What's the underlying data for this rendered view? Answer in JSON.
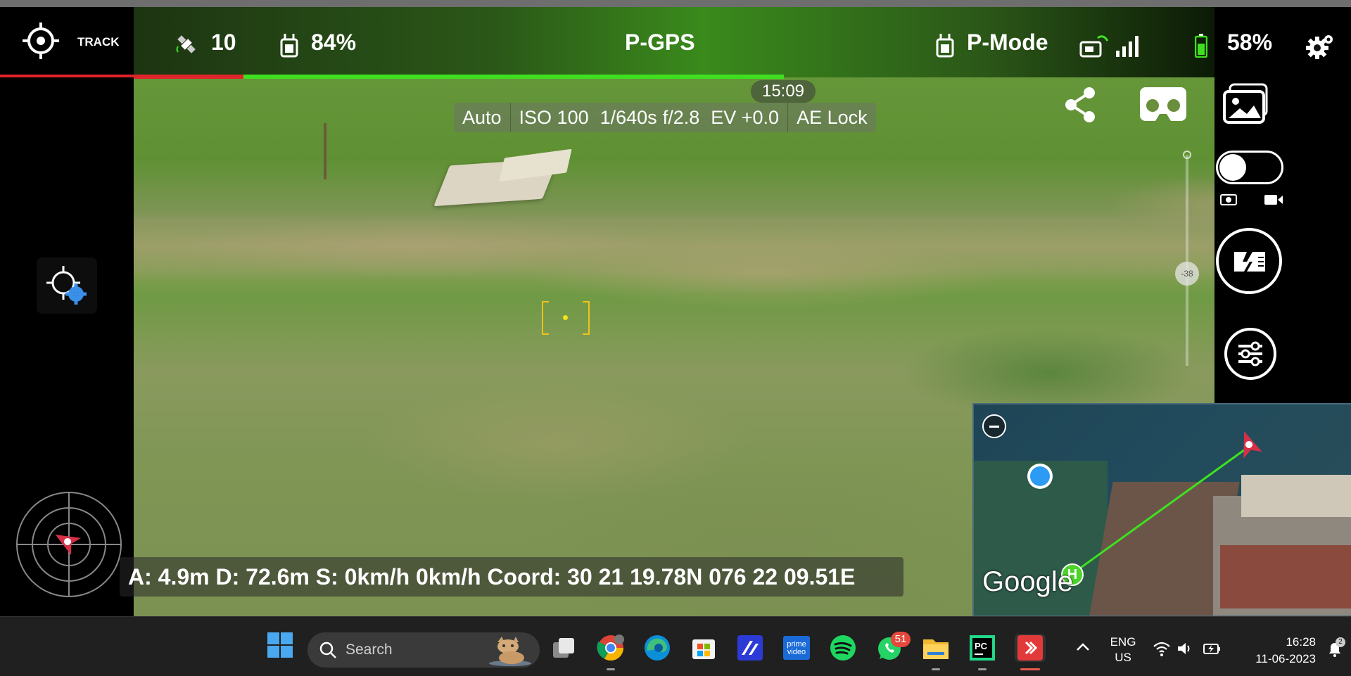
{
  "top_bar": {
    "track_label": "TRACK",
    "satellites": "10",
    "rc_battery": "84%",
    "gps_mode": "P-GPS",
    "flight_mode": "P-Mode",
    "aircraft_battery": "58%"
  },
  "progress": {
    "red_fraction": 0.18,
    "green_fraction": 0.58
  },
  "camera": {
    "time": "15:09",
    "settings": [
      "Auto",
      "ISO 100",
      "1/640s",
      "f/2.8",
      "EV +0.0",
      "AE Lock"
    ],
    "gimbal_angle": "-38"
  },
  "telemetry": "A: 4.9m D: 72.6m S: 0km/h  0km/h Coord: 30 21 19.78N 076 22 09.51E",
  "minimap": {
    "brand": "Google",
    "home_label": "H"
  },
  "taskbar": {
    "search_placeholder": "Search",
    "whatsapp_badge": "51",
    "language_line1": "ENG",
    "language_line2": "US",
    "time": "16:28",
    "date": "11-06-2023",
    "notification_badge": "2"
  },
  "colors": {
    "accent_green": "#3fe020",
    "alert_red": "#e0242b",
    "focus_yellow": "#f2c21a",
    "chrome_blue": "#2b9bf4"
  }
}
